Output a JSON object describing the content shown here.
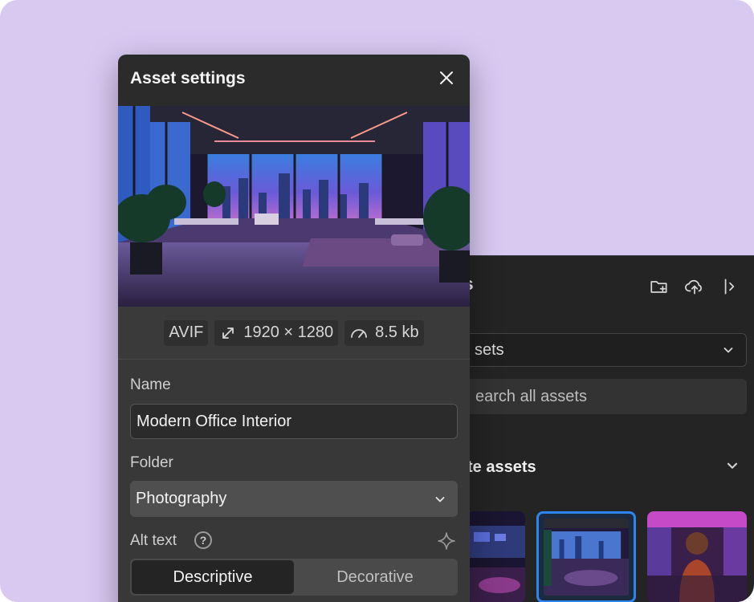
{
  "modal": {
    "title": "Asset settings",
    "meta": {
      "format": "AVIF",
      "dimensions": "1920 × 1280",
      "size": "8.5 kb"
    },
    "name_label": "Name",
    "name_value": "Modern Office Interior",
    "folder_label": "Folder",
    "folder_value": "Photography",
    "alt_label": "Alt text",
    "alt_help": "?",
    "alt_options": [
      "Descriptive",
      "Decorative"
    ],
    "alt_selected": "Descriptive"
  },
  "assets_panel": {
    "title": "ts",
    "select_value": "sets",
    "search_placeholder": "earch all assets",
    "section_title": "te assets"
  },
  "colors": {
    "background": "#d8c9f1",
    "modal": "#2b2b2b",
    "selection": "#2d86f0"
  },
  "icons": [
    "close-icon",
    "resize-icon",
    "gauge-icon",
    "chevron-down-icon",
    "help-icon",
    "sparkle-icon",
    "new-folder-icon",
    "upload-icon",
    "collapse-panel-icon"
  ]
}
